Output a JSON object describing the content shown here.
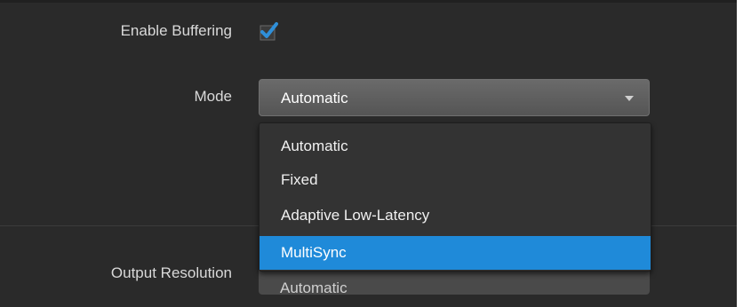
{
  "buffering": {
    "label": "Enable Buffering",
    "checked": true
  },
  "mode": {
    "label": "Mode",
    "value": "Automatic",
    "options": [
      "Automatic",
      "Fixed",
      "Adaptive Low-Latency",
      "MultiSync"
    ],
    "highlighted_option": "MultiSync"
  },
  "output_resolution": {
    "label": "Output Resolution",
    "value": "Automatic"
  },
  "colors": {
    "accent": "#1f8ad9",
    "background": "#2a2a2a",
    "select": "#5f5f5f"
  },
  "icons": {
    "checkbox": "check-icon",
    "caret": "caret-down-icon"
  }
}
